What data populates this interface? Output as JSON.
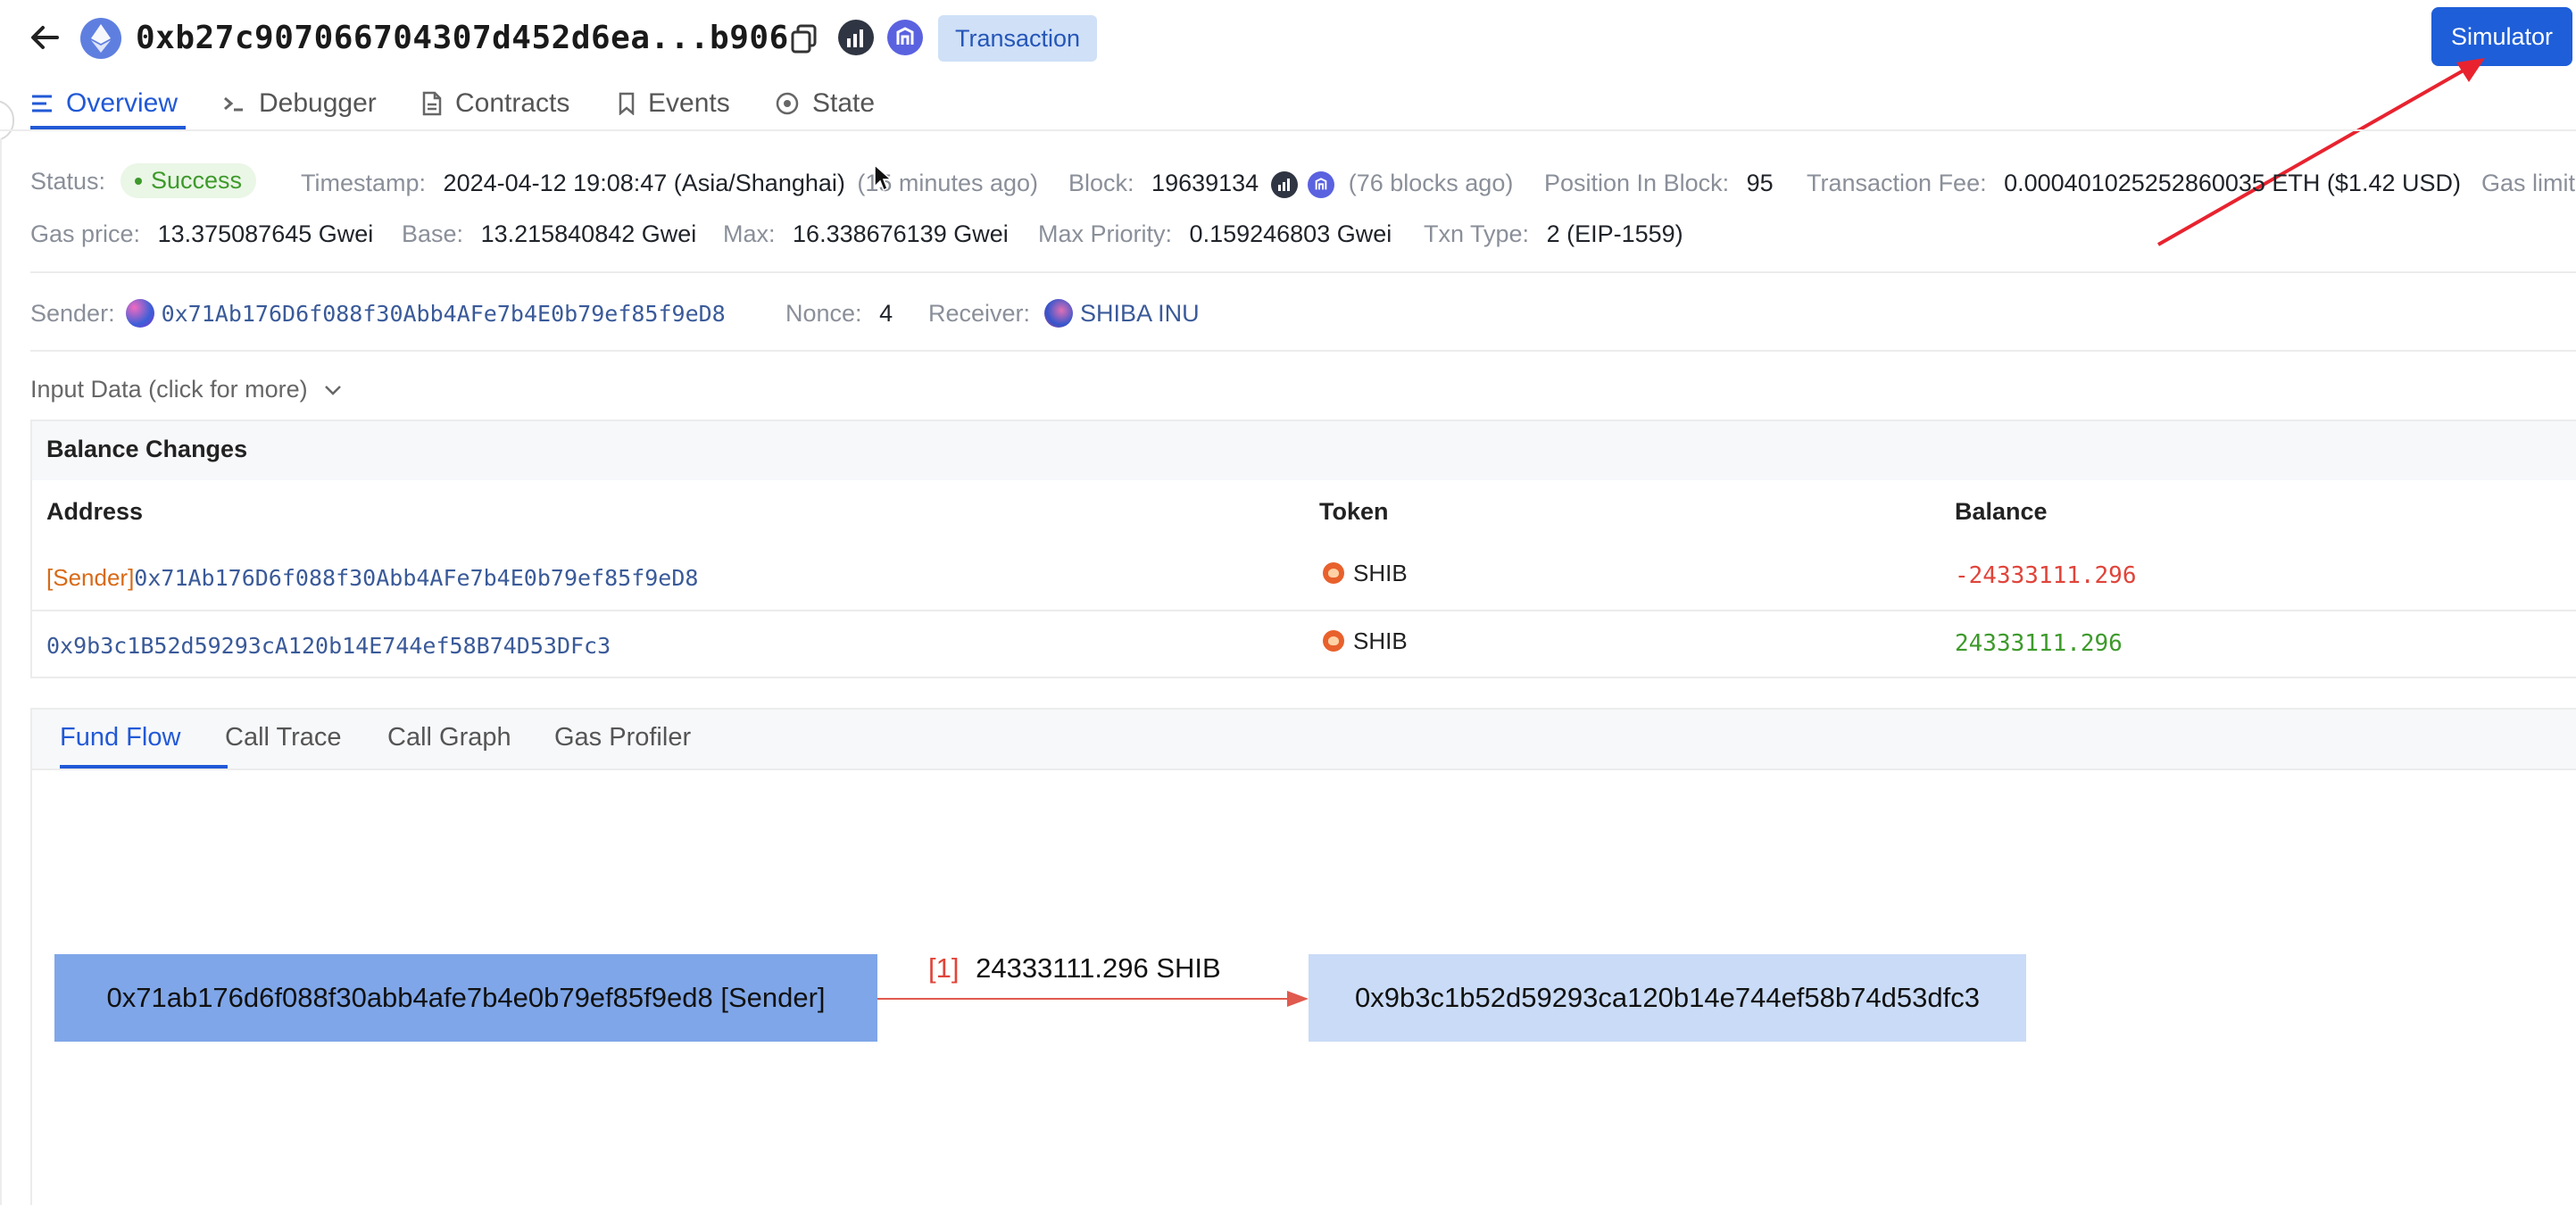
{
  "header": {
    "tx_hash": "0xb27c907066704307d452d6ea...b906",
    "badge": "Transaction",
    "simulator_button": "Simulator"
  },
  "tabs": [
    {
      "label": "Overview",
      "icon": "list-icon",
      "active": true
    },
    {
      "label": "Debugger",
      "icon": "terminal-icon",
      "active": false
    },
    {
      "label": "Contracts",
      "icon": "file-icon",
      "active": false
    },
    {
      "label": "Events",
      "icon": "bookmark-icon",
      "active": false
    },
    {
      "label": "State",
      "icon": "target-icon",
      "active": false
    }
  ],
  "overview": {
    "status_label": "Status:",
    "status_value": "Success",
    "timestamp_label": "Timestamp:",
    "timestamp_value": "2024-04-12 19:08:47 (Asia/Shanghai)",
    "timestamp_ago": "(15 minutes ago)",
    "block_label": "Block:",
    "block_value": "19639134",
    "block_ago": "(76 blocks ago)",
    "position_label": "Position In Block:",
    "position_value": "95",
    "fee_label": "Transaction Fee:",
    "fee_value": "0.000401025252860035 ETH ($1.42 USD)",
    "gas_limit_label": "Gas limit",
    "gas_price_label": "Gas price:",
    "gas_price_value": "13.375087645 Gwei",
    "base_label": "Base:",
    "base_value": "13.215840842 Gwei",
    "max_label": "Max:",
    "max_value": "16.338676139 Gwei",
    "max_priority_label": "Max Priority:",
    "max_priority_value": "0.159246803 Gwei",
    "txn_type_label": "Txn Type:",
    "txn_type_value": "2 (EIP-1559)",
    "sender_label": "Sender:",
    "sender_value": "0x71Ab176D6f088f30Abb4AFe7b4E0b79ef85f9eD8",
    "nonce_label": "Nonce:",
    "nonce_value": "4",
    "receiver_label": "Receiver:",
    "receiver_value": "SHIBA INU",
    "input_data_label": "Input Data (click for more)"
  },
  "balance_changes": {
    "title": "Balance Changes",
    "columns": [
      "Address",
      "Token",
      "Balance"
    ],
    "rows": [
      {
        "tag": "[Sender]",
        "address": "0x71Ab176D6f088f30Abb4AFe7b4E0b79ef85f9eD8",
        "token": "SHIB",
        "balance": "-24333111.296"
      },
      {
        "tag": "",
        "address": "0x9b3c1B52d59293cA120b14E744ef58B74D53DFc3",
        "token": "SHIB",
        "balance": "24333111.296"
      }
    ]
  },
  "bottom_tabs": [
    {
      "label": "Fund Flow",
      "active": true
    },
    {
      "label": "Call Trace",
      "active": false
    },
    {
      "label": "Call Graph",
      "active": false
    },
    {
      "label": "Gas Profiler",
      "active": false
    }
  ],
  "fund_flow": {
    "from_node": "0x71ab176d6f088f30abb4afe7b4e0b79ef85f9ed8 [Sender]",
    "to_node": "0x9b3c1b52d59293ca120b14e744ef58b74d53dfc3",
    "edge_index": "[1]",
    "edge_amount": "24333111.296 SHIB"
  },
  "colors": {
    "accent": "#2159d6",
    "success": "#3d9a2b",
    "negative": "#e0443a",
    "sender_tag": "#d86a16",
    "node_from": "#7fa6e8",
    "node_to": "#c9dbf6",
    "annotation_arrow": "#e8232f"
  }
}
